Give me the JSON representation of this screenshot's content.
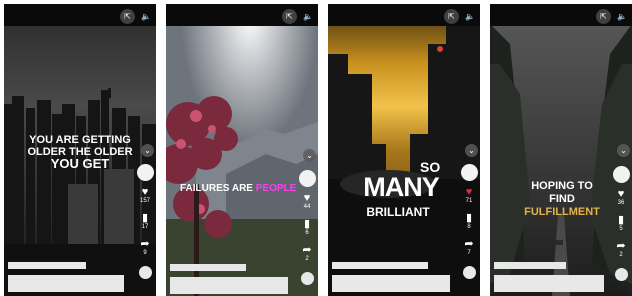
{
  "videos": [
    {
      "caption_lines": [
        "YOU ARE GETTING",
        "OLDER THE OLDER",
        "YOU GET"
      ],
      "counts": {
        "likes": "157",
        "saves": "17",
        "shares": "9"
      }
    },
    {
      "caption_plain": "FAILURES ARE ",
      "caption_highlight": "PEOPLE",
      "counts": {
        "likes": "44",
        "saves": "6",
        "shares": "2"
      }
    },
    {
      "caption_lines": [
        "SO",
        "MANY",
        "BRILLIANT"
      ],
      "counts": {
        "likes": "71",
        "saves": "8",
        "shares": "7"
      }
    },
    {
      "caption_lines": [
        "HOPING TO",
        "FIND"
      ],
      "caption_highlight": "FULFILLMENT",
      "counts": {
        "likes": "36",
        "saves": "5",
        "shares": "2"
      }
    }
  ],
  "icons": {
    "transfer": "transfer-icon",
    "sound": "speaker-icon",
    "more": "chevron-down-icon",
    "like": "heart-icon",
    "save": "bookmark-icon",
    "share": "share-arrow-icon"
  },
  "colors": {
    "highlight_pink": "#ff3df2",
    "highlight_gold": "#e3b44a"
  }
}
